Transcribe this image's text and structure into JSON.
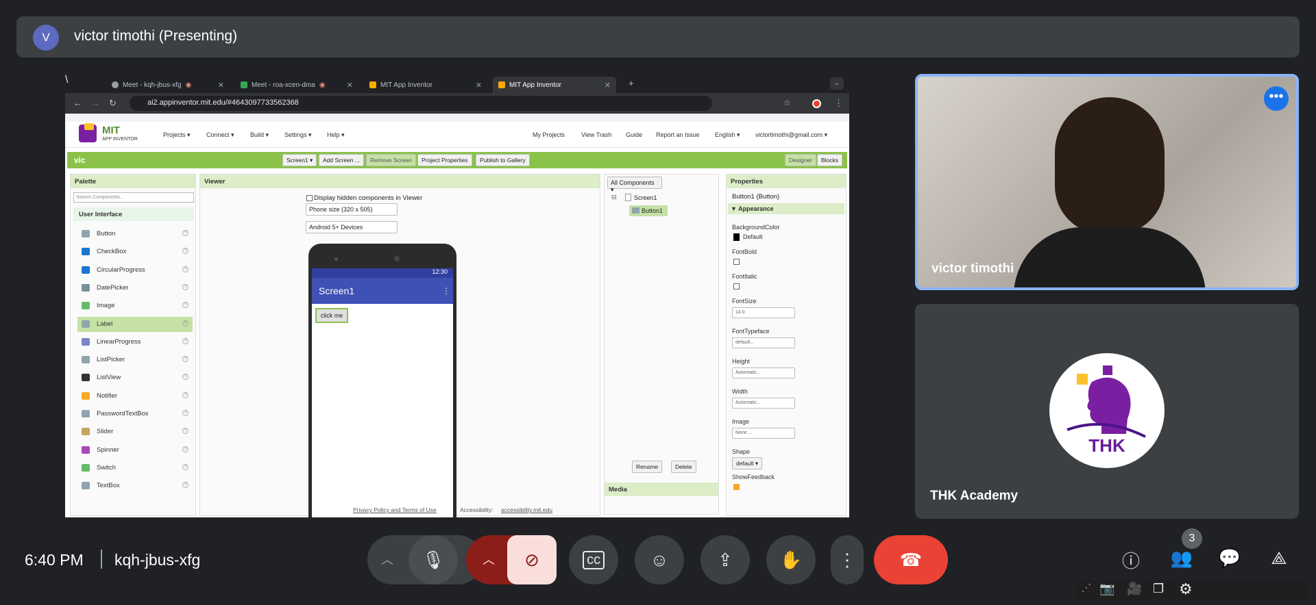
{
  "presenter": {
    "initial": "V",
    "label": "victor timothi (Presenting)"
  },
  "browser": {
    "tabs": [
      {
        "title": "Meet - kqh-jbus-xfg"
      },
      {
        "title": "Meet - roa-xcen-dma"
      },
      {
        "title": "MIT App Inventor"
      },
      {
        "title": "MIT App Inventor"
      }
    ],
    "url": "ai2.appinventor.mit.edu/#4643097733562368"
  },
  "appinventor": {
    "brand": "MIT",
    "brand_sub": "APP INVENTOR",
    "menu": [
      "Projects ▾",
      "Connect ▾",
      "Build ▾",
      "Settings ▾",
      "Help ▾"
    ],
    "right_menu": [
      "My Projects",
      "View Trash",
      "Guide",
      "Report an Issue",
      "English ▾",
      "victortimothi@gmail.com ▾"
    ],
    "project": "vic",
    "toolbar": [
      "Screen1 ▾",
      "Add Screen ...",
      "Remove Screen",
      "Project Properties",
      "Publish to Gallery"
    ],
    "mode": [
      "Designer",
      "Blocks"
    ],
    "palette": {
      "title": "Palette",
      "search": "Search Components...",
      "section": "User Interface",
      "items": [
        "Button",
        "CheckBox",
        "CircularProgress",
        "DatePicker",
        "Image",
        "Label",
        "LinearProgress",
        "ListPicker",
        "ListView",
        "Notifier",
        "PasswordTextBox",
        "Slider",
        "Spinner",
        "Switch",
        "TextBox"
      ]
    },
    "viewer": {
      "title": "Viewer",
      "hidden": "Display hidden components in Viewer",
      "size": "Phone size (320 x 505)",
      "device": "Android 5+ Devices",
      "time": "12:30",
      "screen_title": "Screen1",
      "button": "click me"
    },
    "components": {
      "dropdown": "All Components ▾",
      "root": "Screen1",
      "child": "Button1",
      "rename": "Rename",
      "delete": "Delete",
      "media": "Media"
    },
    "properties": {
      "title": "Properties",
      "selected": "Button1 (Button)",
      "section": "▼ Appearance",
      "bg_label": "BackgroundColor",
      "bg_value": "Default",
      "fontbold": "FontBold",
      "fontitalic": "FontItalic",
      "fontsize": "FontSize",
      "fontsize_val": "14.0",
      "typeface": "FontTypeface",
      "typeface_val": "default...",
      "height": "Height",
      "height_val": "Automatic...",
      "width": "Width",
      "width_val": "Automatic...",
      "image": "Image",
      "image_val": "None ...",
      "shape": "Shape",
      "shape_val": "default ▾",
      "feedback": "ShowFeedback"
    },
    "footer": {
      "policy": "Privacy Policy and Terms of Use",
      "access": "Accessibility:",
      "access_link": "accessibility.mit.edu"
    }
  },
  "participants": {
    "cam_name": "victor timothi",
    "thk_name": "THK Academy",
    "thk_logo": "THK"
  },
  "footer": {
    "time": "6:40 PM",
    "code": "kqh-jbus-xfg",
    "people_count": "3"
  },
  "colors": {
    "end_call": "#ea4335",
    "cam_off": "#f9dedc",
    "green": "#8bc34a",
    "indigo": "#3f51b5"
  }
}
